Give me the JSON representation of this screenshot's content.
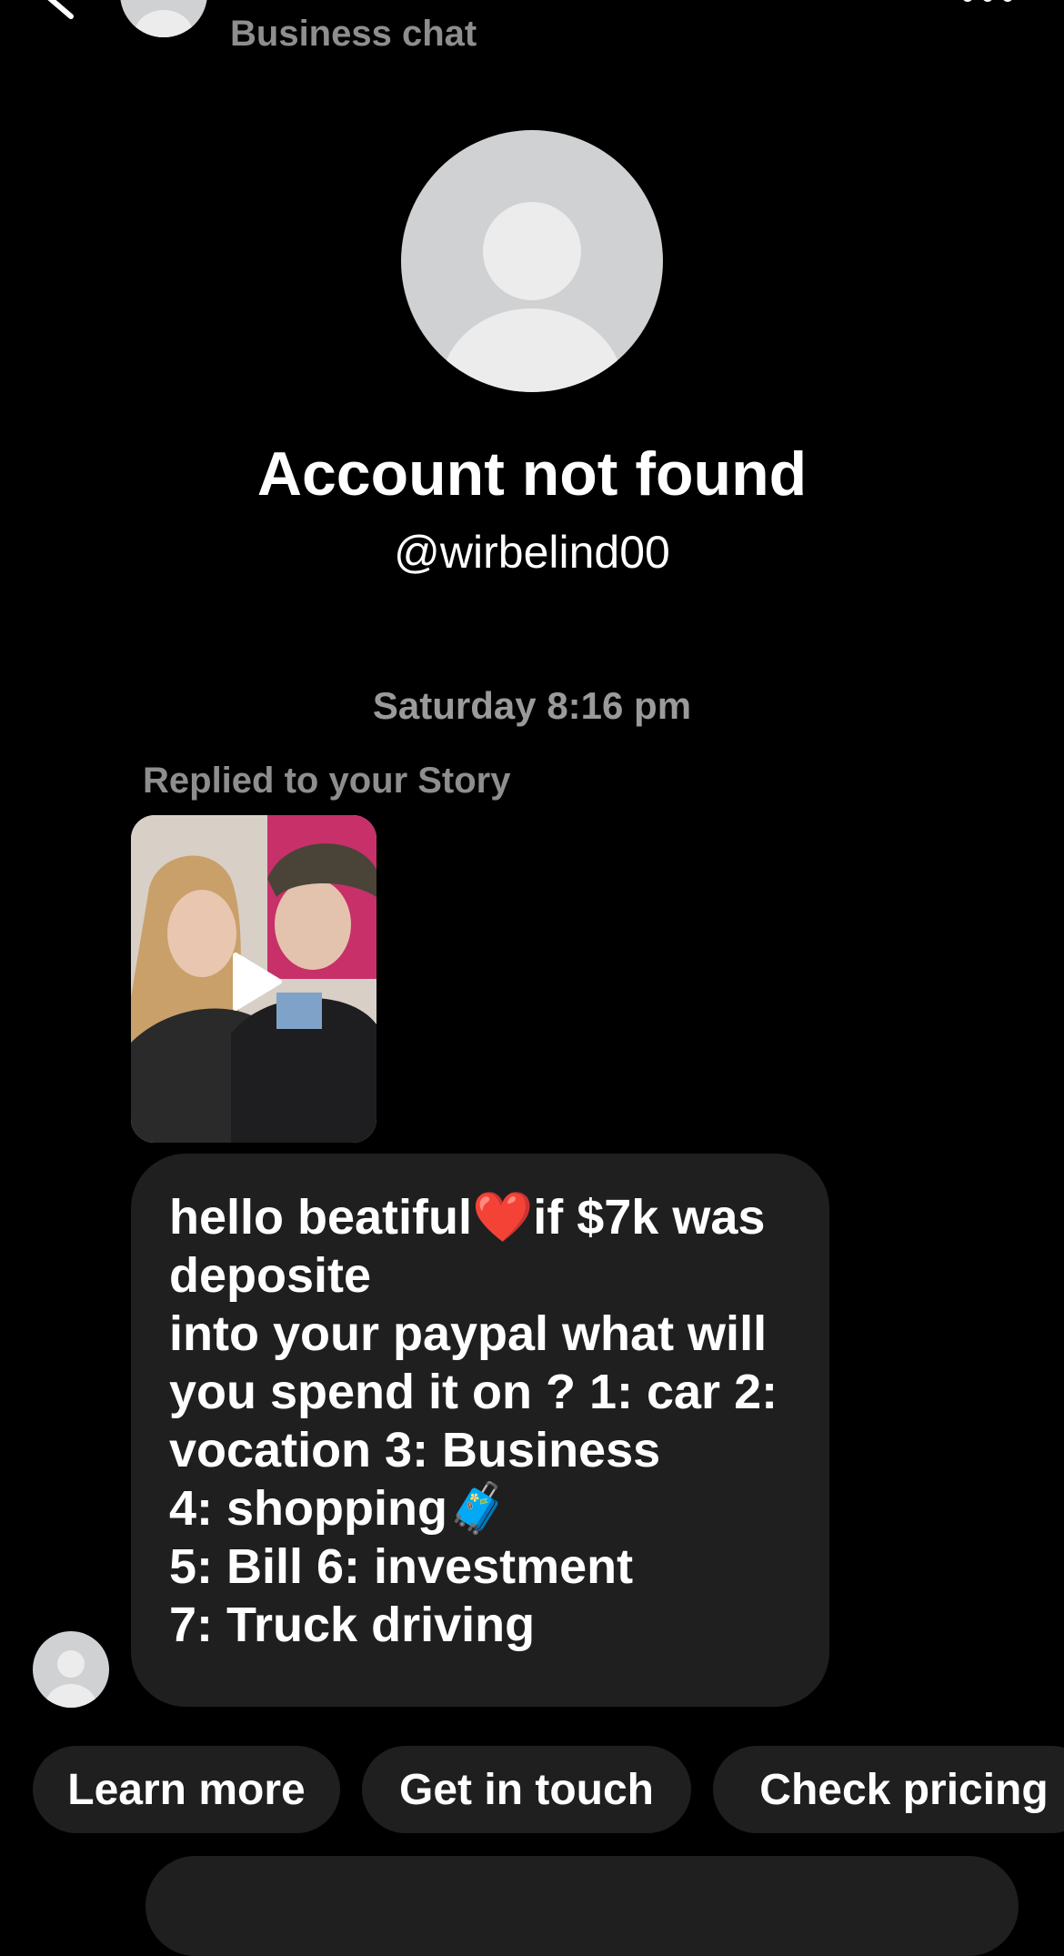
{
  "header": {
    "subtitle": "Business chat",
    "back_icon": "chevron-left-icon",
    "more_icon": "more-dots-icon"
  },
  "profile": {
    "name": "Account not found",
    "handle": "@wirbelind00",
    "avatar_icon": "default-avatar-icon"
  },
  "conversation": {
    "timestamp": "Saturday 8:16 pm",
    "story_reply_label": "Replied to your Story",
    "story_thumbnail_icon": "play-icon",
    "message": "hello beatiful❤️if $7k was deposite\ninto your paypal what will you spend it on ? 1: car 2: vocation 3: Business\n4: shopping🧳\n5: Bill 6: investment\n7: Truck driving"
  },
  "quick_replies": [
    {
      "label": "Learn more"
    },
    {
      "label": "Get in touch"
    },
    {
      "label": "Check pricing"
    }
  ],
  "colors": {
    "background": "#000000",
    "bubble": "#1f1f1f",
    "secondary_text": "#8e8e8e",
    "avatar_placeholder": "#cfd1d2"
  }
}
